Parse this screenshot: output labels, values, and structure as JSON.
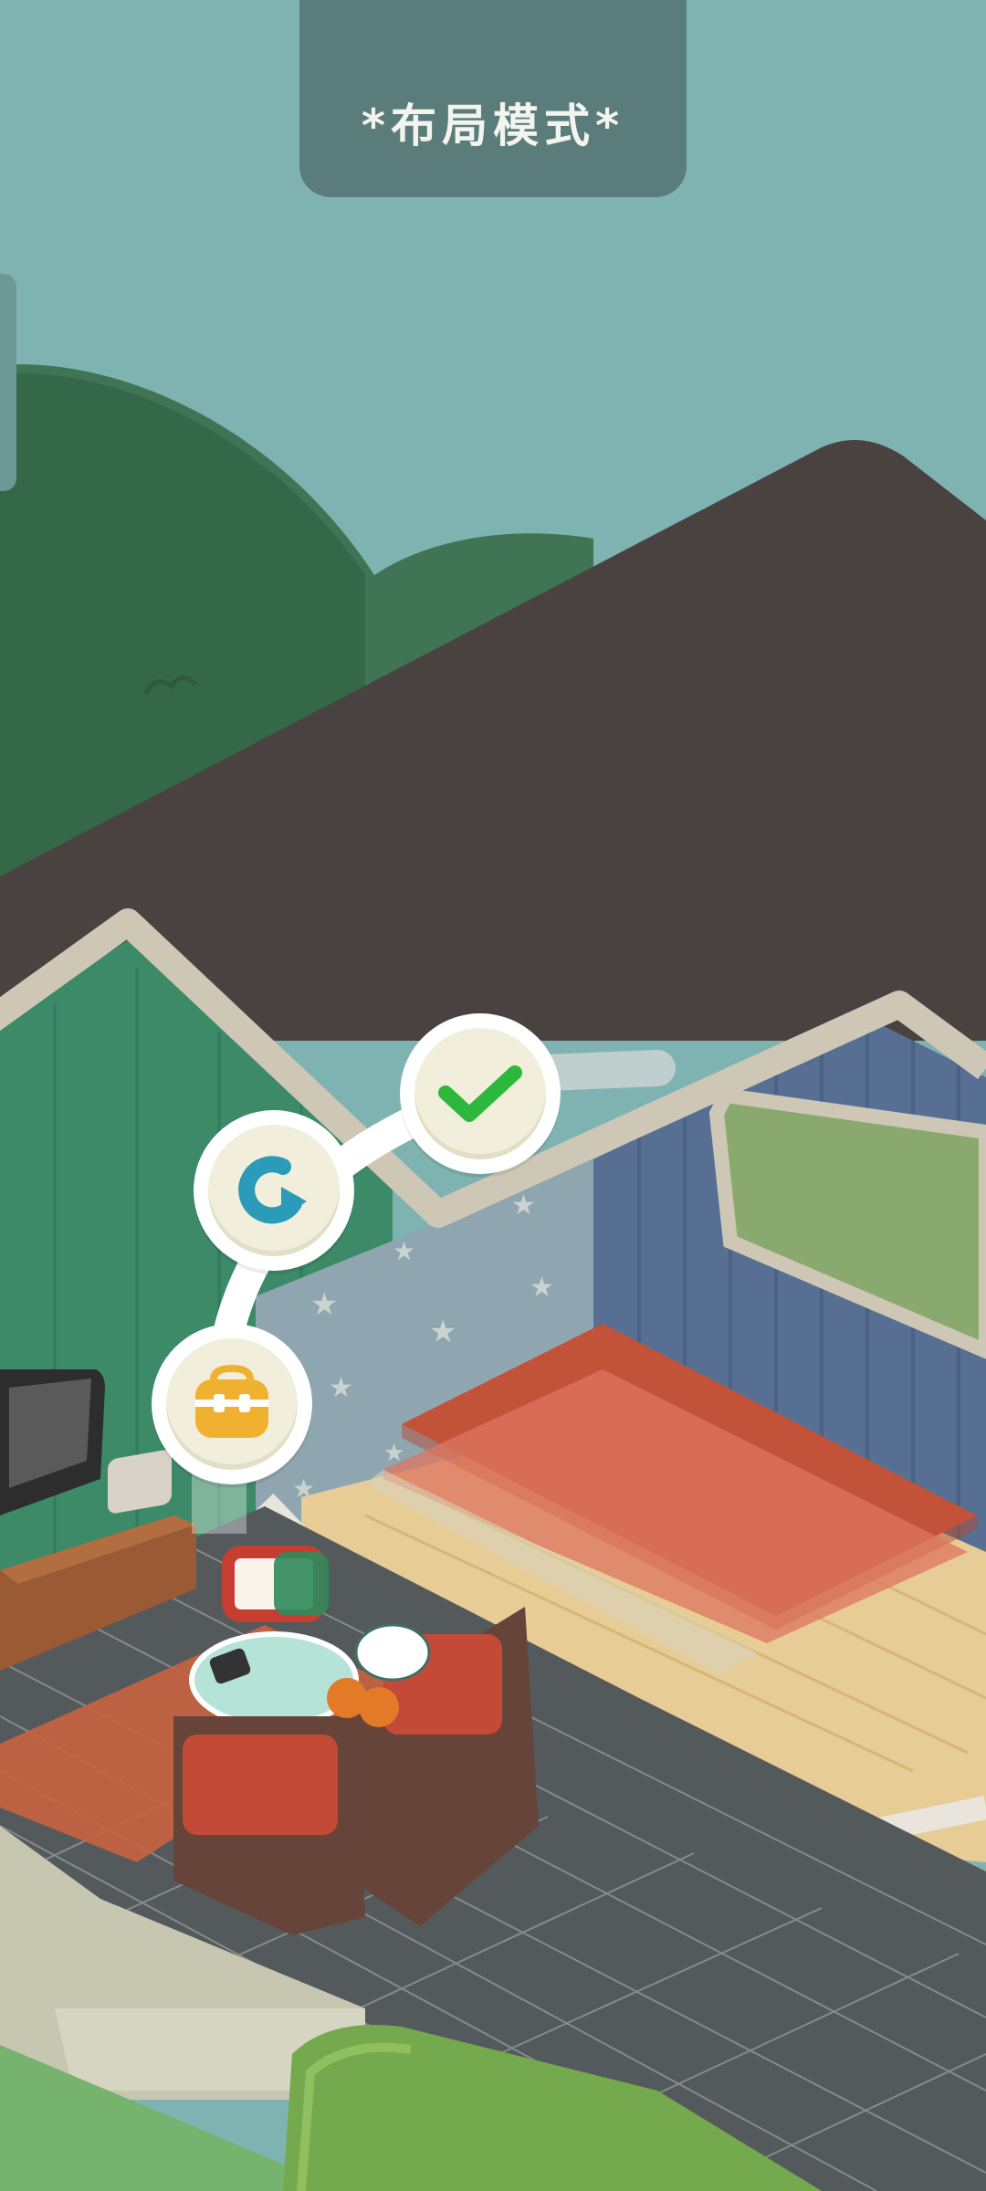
{
  "header": {
    "mode_label": "*布局模式*"
  },
  "actions": {
    "confirm_icon": "checkmark-icon",
    "rotate_icon": "rotate-icon",
    "store_icon": "backpack-icon"
  },
  "colors": {
    "sky": "#7fb3b1",
    "banner": "#5a7d7c",
    "roof": "#4a4240",
    "confirm": "#2db83d",
    "rotate": "#2a9bb8",
    "store": "#f0b131",
    "rug": "#d9694a"
  }
}
